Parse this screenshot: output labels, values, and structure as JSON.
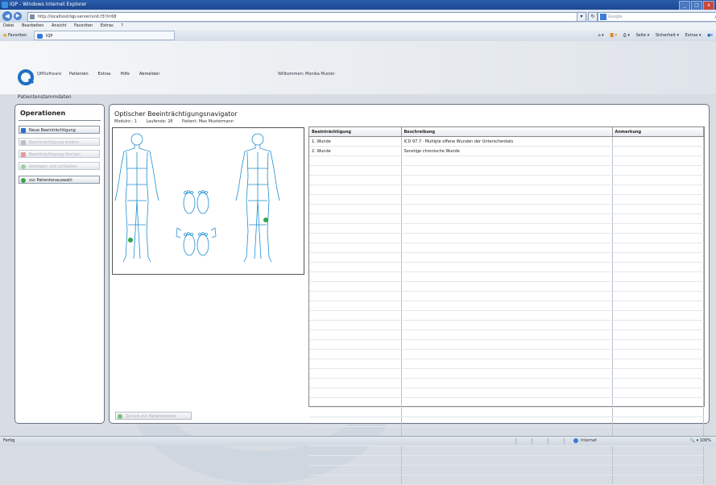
{
  "window": {
    "title": "IQP - Windows Internet Explorer",
    "controls": [
      "_",
      "□",
      "x"
    ]
  },
  "browser": {
    "address": "http://localhost/iqp-server/unit.f3?/rr68",
    "search_placeholder": "Google",
    "menu": [
      "Datei",
      "Bearbeiten",
      "Ansicht",
      "Favoriten",
      "Extras",
      "?"
    ],
    "favorites_label": "Favoriten",
    "tab_label": "IQP",
    "command_bar": [
      "Seite ▾",
      "Sicherheit ▾",
      "Extras ▾"
    ]
  },
  "app": {
    "brand": "QMSoftware",
    "top_menu": [
      "Patienten",
      "Extras",
      "Hilfe",
      "Abmelden"
    ],
    "welcome": "Willkommen: Monika Muster",
    "section_title": "Patientenstammdaten"
  },
  "operations": {
    "title": "Operationen",
    "buttons": [
      {
        "label": "Neue Beeinträchtigung",
        "enabled": true,
        "icon": "add-icon",
        "color": "#2f6fc4"
      },
      {
        "label": "Beeinträchtigung ändern",
        "enabled": false,
        "icon": "edit-icon",
        "color": "#b9c0c8"
      },
      {
        "label": "Beeinträchtigung löschen",
        "enabled": false,
        "icon": "delete-icon",
        "color": "#e59b9b"
      },
      {
        "label": "Anzeigen und schließen",
        "enabled": false,
        "icon": "check-icon",
        "color": "#9fd09f"
      },
      {
        "label": "zur Patientenauswahl",
        "enabled": true,
        "icon": "back-icon",
        "color": "#3fa34a"
      }
    ]
  },
  "navigator": {
    "title": "Optischer Beeinträchtigungsnavigator",
    "meta": {
      "modul": "Modulnr.: 1",
      "laufende": "Laufende: 28",
      "patient": "Patient: Max Mustermann"
    },
    "table": {
      "columns": [
        "Beeinträchtigung",
        "Beschreibung",
        "Anmerkung"
      ],
      "rows": [
        [
          "1. Wunde",
          "ICD 97.7 · Multiple offene Wunden der Unterschenkels",
          ""
        ],
        [
          "2. Wunde",
          "Sonstige chronische Wunde",
          ""
        ]
      ]
    },
    "back_button": "Zurück zur Patientenliste"
  },
  "status": {
    "left": "Fertig",
    "zone": "Internet",
    "zoom": "100%"
  }
}
